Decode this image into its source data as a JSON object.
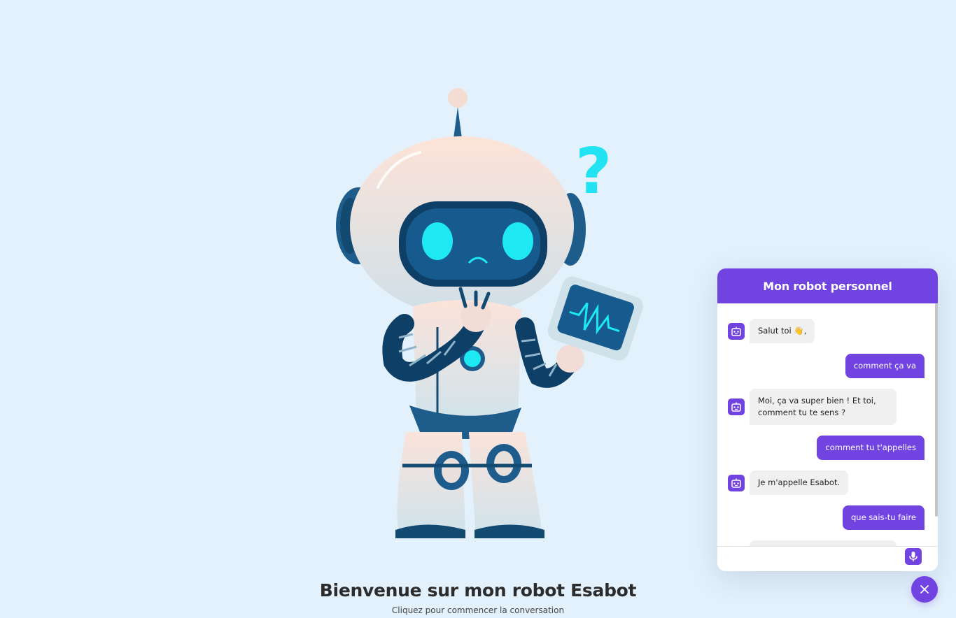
{
  "page": {
    "title": "Bienvenue sur mon robot Esabot",
    "subtitle": "Cliquez pour commencer la conversation"
  },
  "chat": {
    "header_title": "Mon robot personnel",
    "messages": [
      {
        "from": "bot",
        "text": "Salut toi 👋,"
      },
      {
        "from": "user",
        "text": "comment ça va"
      },
      {
        "from": "bot",
        "text": "Moi, ça va super bien ! Et toi, comment tu te sens ?"
      },
      {
        "from": "user",
        "text": "comment tu t'appelles"
      },
      {
        "from": "bot",
        "text": "Je m'appelle Esabot."
      },
      {
        "from": "user",
        "text": "que sais-tu faire"
      }
    ],
    "input": {
      "value": "",
      "placeholder": ""
    },
    "mic_icon": "microphone-icon",
    "close_icon": "close-icon",
    "bot_avatar_icon": "robot-icon"
  },
  "colors": {
    "accent": "#7144e2",
    "background": "#e3f1fc",
    "bot_bubble": "#f0f0f0"
  }
}
